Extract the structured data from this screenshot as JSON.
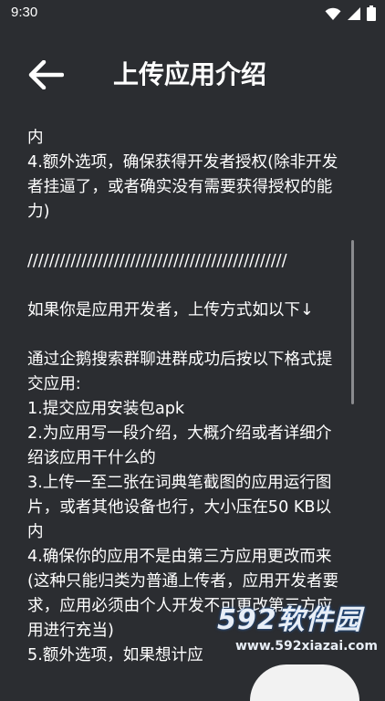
{
  "status_bar": {
    "time": "9:30",
    "icons": [
      "wifi-icon",
      "signal-icon",
      "battery-icon"
    ]
  },
  "header": {
    "back_icon": "arrow-left-icon",
    "title": "上传应用介绍"
  },
  "content": {
    "lines": [
      "内",
      "4.额外选项，确保获得开发者授权(除非开发",
      "者挂逼了，或者确实没有需要获得授权的能",
      "力)",
      "",
      "////////////////////////////////////////////////",
      "",
      "如果你是应用开发者，上传方式如以下↓",
      "",
      "通过企鹅搜索群聊进群成功后按以下格式提",
      "交应用:",
      "1.提交应用安装包apk",
      "2.为应用写一段介绍，大概介绍或者详细介",
      "绍该应用干什么的",
      "3.上传一至二张在词典笔截图的应用运行图",
      "片，或者其他设备也行，大小压在50 KB以",
      "内",
      "4.确保你的应用不是由第三方应用更改而来",
      "(这种只能归类为普通上传者，应用开发者要",
      "求，应用必须由个人开发不可更改第三方应",
      "用进行充当)",
      "5.额外选项，如果想计应"
    ]
  },
  "watermark": {
    "brand": "592软件园",
    "url": "www.592xiazai.com"
  },
  "colors": {
    "background": "#2b2d31",
    "text": "#ffffff",
    "scrollbar": "#8a8b8e"
  }
}
